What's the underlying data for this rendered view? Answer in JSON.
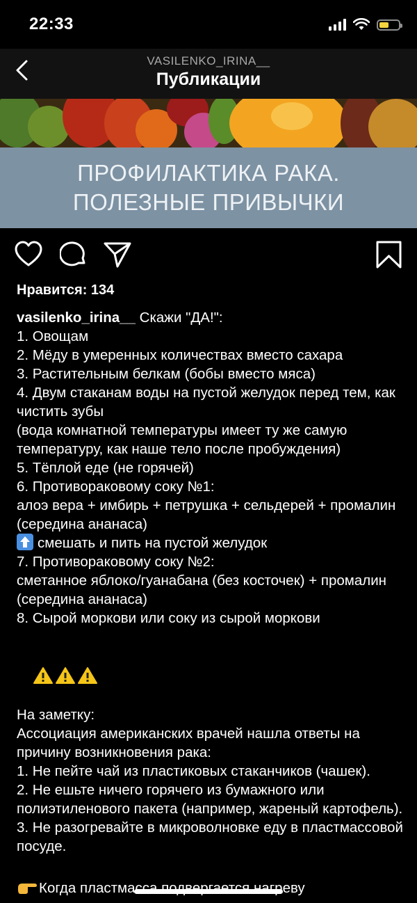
{
  "status": {
    "time": "22:33"
  },
  "nav": {
    "username": "VASILENKO_IRINA__",
    "title": "Публикации"
  },
  "post": {
    "banner_line1": "ПРОФИЛАКТИКА РАКА.",
    "banner_line2": "ПОЛЕЗНЫЕ ПРИВЫЧКИ",
    "likes": "Нравится: 134",
    "username": "vasilenko_irina__",
    "caption_intro": " Скажи \"ДА!\":",
    "lines": [
      "1. Овощам",
      "2. Мёду в умеренных количествах вместо сахара",
      "3. Растительным белкам (бобы вместо мяса)",
      "4. Двум стаканам воды на пустой желудок перед тем, как чистить зубы",
      "(вода комнатной температуры имеет ту же самую температуру, как наше тело после пробуждения)",
      "5. Тёплой еде (не горячей)",
      "6. Противораковому соку №1:",
      "алоэ вера + имбирь + петрушка + сельдерей + промалин (середина ананаса)",
      "смешать и пить на пустой желудок",
      "7. Противораковому соку №2:",
      "сметанное яблоко/гуанабана (без косточек) + промалин (середина ананаса)",
      "8. Сырой моркови или соку из сырой моркови",
      "",
      "На заметку:",
      "Ассоциация американских врачей нашла ответы на причину возникновения рака:",
      "1. Не пейте чай из пластиковых стаканчиков (чашек).",
      "2. Не ешьте ничего горячего из бумажного или полиэтиленового пакета (например, жареный картофель).",
      "3. Не разогревайте в микроволновке еду в пластмассовой посуде.",
      "",
      "Когда пластмасса подвергается нагреву"
    ]
  },
  "icons": {
    "back": "chevron-left-icon",
    "like": "heart-icon",
    "comment": "comment-icon",
    "share": "paper-plane-icon",
    "save": "bookmark-icon",
    "up": "up-arrow-emoji-icon",
    "warning": "warning-emoji-icon",
    "pointing": "pointing-hand-emoji-icon"
  },
  "colors": {
    "background": "#000000",
    "banner": "#7d92a3",
    "battery": "#f5d33e"
  }
}
